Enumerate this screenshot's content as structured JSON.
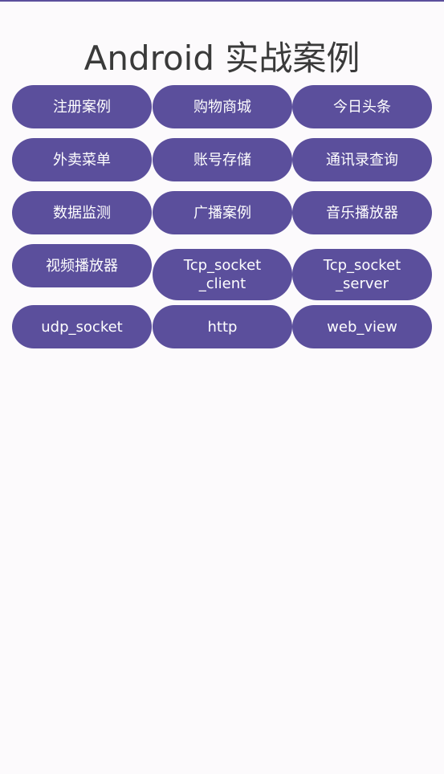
{
  "app": {
    "title": "Android 实战案例"
  },
  "buttons": [
    {
      "label": "注册案例"
    },
    {
      "label": "购物商城"
    },
    {
      "label": "今日头条"
    },
    {
      "label": "外卖菜单"
    },
    {
      "label": "账号存储"
    },
    {
      "label": "通讯录查询"
    },
    {
      "label": "数据监测"
    },
    {
      "label": "广播案例"
    },
    {
      "label": "音乐播放器"
    },
    {
      "label": "视频播放器"
    },
    {
      "label": "Tcp_socket\n_client"
    },
    {
      "label": "Tcp_socket\n_server"
    },
    {
      "label": "udp_socket"
    },
    {
      "label": "http"
    },
    {
      "label": "web_view"
    }
  ],
  "colors": {
    "accent": "#5b4f9c",
    "background": "#fcfafc",
    "title_text": "#3a3a3a"
  }
}
